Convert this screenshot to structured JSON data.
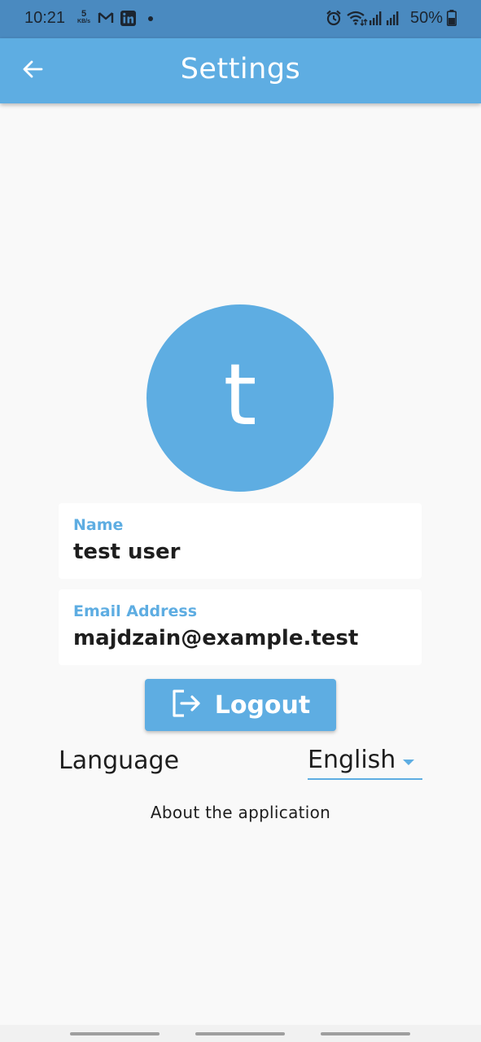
{
  "status_bar": {
    "time": "10:21",
    "net_speed_value": "5",
    "net_speed_unit": "KB/s",
    "battery_percent": "50%",
    "icons": [
      "gmail-icon",
      "linkedin-icon",
      "notification-dot-icon",
      "alarm-icon",
      "wifi-icon",
      "signal-icon",
      "battery-icon"
    ]
  },
  "app_bar": {
    "title": "Settings",
    "back_icon": "arrow-left-icon",
    "color": "#5eade2"
  },
  "avatar": {
    "initial": "t"
  },
  "profile": {
    "name_label": "Name",
    "name_value": "test user",
    "email_label": "Email Address",
    "email_value": "majdzain@example.test"
  },
  "actions": {
    "logout_label": "Logout",
    "logout_icon": "logout-icon"
  },
  "language": {
    "label": "Language",
    "selected": "English"
  },
  "about": {
    "label": "About the application"
  },
  "colors": {
    "primary": "#5eade2",
    "status_bar": "#4a8ac0",
    "background": "#f9f9f9",
    "text": "#1e1e1e"
  }
}
